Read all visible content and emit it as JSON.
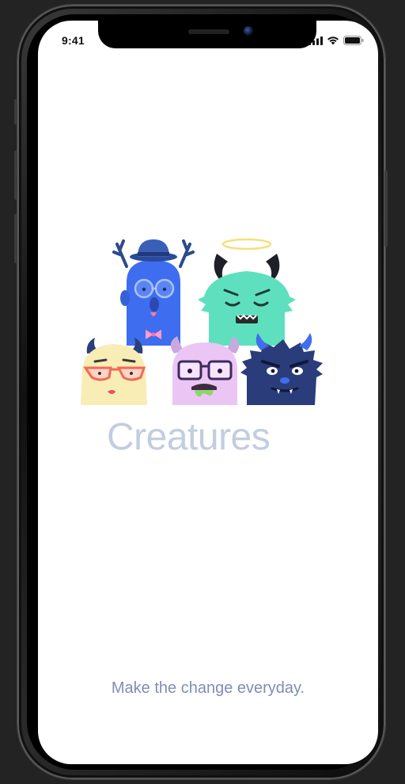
{
  "status_bar": {
    "time": "9:41",
    "icons": [
      "cellular-signal-icon",
      "wifi-icon",
      "battery-icon"
    ]
  },
  "app": {
    "title": "Creatures",
    "tagline": "Make the change everyday."
  },
  "illustration": {
    "characters": [
      "blue-monster-with-antlers-and-hat",
      "green-monster-with-horns-and-halo",
      "yellow-monster-with-red-glasses",
      "pink-monster-with-glasses",
      "navy-furry-monster-with-horns"
    ]
  },
  "colors": {
    "title": "#c3cde0",
    "tagline": "#7f8fb0",
    "screen_background": "#ffffff"
  }
}
